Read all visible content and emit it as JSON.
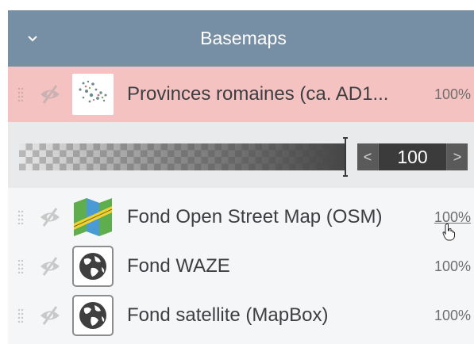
{
  "header": {
    "title": "Basemaps",
    "toggle_icon": "chevron-down-icon"
  },
  "layers": [
    {
      "label": "Provinces romaines (ca. AD1...",
      "opacity": "100%",
      "thumb": "ancient-map-thumbnail",
      "visible_icon": "eye-slash-icon",
      "active": true
    },
    {
      "label": "Fond Open Street Map (OSM)",
      "opacity": "100%",
      "thumb": "map-icon",
      "visible_icon": "eye-slash-icon",
      "hover": true
    },
    {
      "label": "Fond WAZE",
      "opacity": "100%",
      "thumb": "globe-icon",
      "visible_icon": "eye-slash-icon"
    },
    {
      "label": "Fond satellite (MapBox)",
      "opacity": "100%",
      "thumb": "globe-icon",
      "visible_icon": "eye-slash-icon"
    }
  ],
  "opacity_control": {
    "value": "100",
    "prev_label": "<",
    "next_label": ">",
    "level": 1.0
  },
  "colors": {
    "header_bg": "#778fa4",
    "active_row_bg": "#f5c2c2",
    "panel_bg": "#f5f6f7"
  }
}
